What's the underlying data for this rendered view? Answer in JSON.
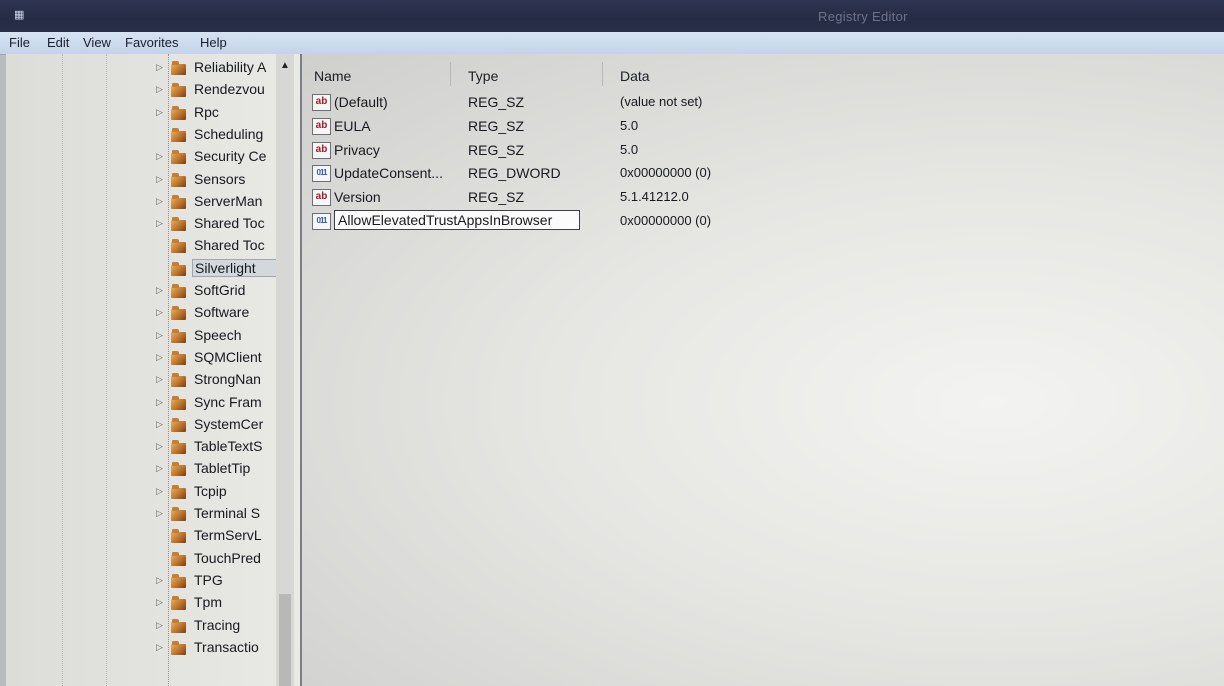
{
  "window": {
    "title": "Registry Editor",
    "app_icon": "registry-editor-icon"
  },
  "menu": [
    "File",
    "Edit",
    "View",
    "Favorites",
    "Help"
  ],
  "tree": {
    "items": [
      {
        "label": "Reliability A",
        "expandable": true
      },
      {
        "label": "Rendezvou",
        "expandable": true
      },
      {
        "label": "Rpc",
        "expandable": true
      },
      {
        "label": "Scheduling",
        "expandable": false
      },
      {
        "label": "Security Ce",
        "expandable": true
      },
      {
        "label": "Sensors",
        "expandable": true
      },
      {
        "label": "ServerMan",
        "expandable": true
      },
      {
        "label": "Shared Toc",
        "expandable": true
      },
      {
        "label": "Shared Toc",
        "expandable": false
      },
      {
        "label": "Silverlight",
        "expandable": false,
        "selected": true
      },
      {
        "label": "SoftGrid",
        "expandable": true
      },
      {
        "label": "Software",
        "expandable": true
      },
      {
        "label": "Speech",
        "expandable": true
      },
      {
        "label": "SQMClient",
        "expandable": true
      },
      {
        "label": "StrongNan",
        "expandable": true
      },
      {
        "label": "Sync Fram",
        "expandable": true
      },
      {
        "label": "SystemCer",
        "expandable": true
      },
      {
        "label": "TableTextS",
        "expandable": true
      },
      {
        "label": "TabletTip",
        "expandable": true
      },
      {
        "label": "Tcpip",
        "expandable": true
      },
      {
        "label": "Terminal S",
        "expandable": true
      },
      {
        "label": "TermServL",
        "expandable": false
      },
      {
        "label": "TouchPred",
        "expandable": false
      },
      {
        "label": "TPG",
        "expandable": true
      },
      {
        "label": "Tpm",
        "expandable": true
      },
      {
        "label": "Tracing",
        "expandable": true
      },
      {
        "label": "Transactio",
        "expandable": true
      }
    ]
  },
  "list": {
    "columns": {
      "name": "Name",
      "type": "Type",
      "data": "Data"
    },
    "rows": [
      {
        "icon": "string-value-icon",
        "icon_text": "ab",
        "name": "(Default)",
        "type": "REG_SZ",
        "data": "(value not set)"
      },
      {
        "icon": "string-value-icon",
        "icon_text": "ab",
        "name": "EULA",
        "type": "REG_SZ",
        "data": "5.0"
      },
      {
        "icon": "string-value-icon",
        "icon_text": "ab",
        "name": "Privacy",
        "type": "REG_SZ",
        "data": "5.0"
      },
      {
        "icon": "binary-value-icon",
        "icon_text": "011",
        "name": "UpdateConsent...",
        "type": "REG_DWORD",
        "data": "0x00000000 (0)"
      },
      {
        "icon": "string-value-icon",
        "icon_text": "ab",
        "name": "Version",
        "type": "REG_SZ",
        "data": "5.1.41212.0"
      },
      {
        "icon": "binary-value-icon",
        "icon_text": "011",
        "name": "AllowElevatedTrustAppsInBrowser",
        "type": "",
        "data": "0x00000000 (0)",
        "editing": true
      }
    ]
  }
}
